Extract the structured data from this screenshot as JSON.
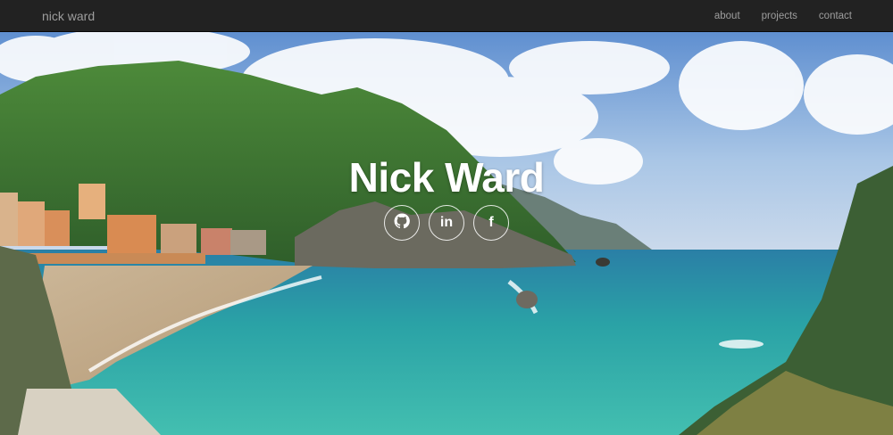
{
  "nav": {
    "brand": "nick ward",
    "links": [
      {
        "label": "about"
      },
      {
        "label": "projects"
      },
      {
        "label": "contact"
      }
    ]
  },
  "hero": {
    "title": "Nick Ward",
    "background": "photo of a coastal village with green hills, beach and turquoise sea",
    "socials": [
      {
        "icon": "github-icon"
      },
      {
        "icon": "linkedin-icon",
        "text": "in"
      },
      {
        "icon": "facebook-icon",
        "text": "f"
      }
    ]
  },
  "colors": {
    "navbar": "#222222",
    "nav_text": "#9d9d9d",
    "title": "#ffffff",
    "sky": "#8fb6e0",
    "sea": "#2fa3a0"
  }
}
